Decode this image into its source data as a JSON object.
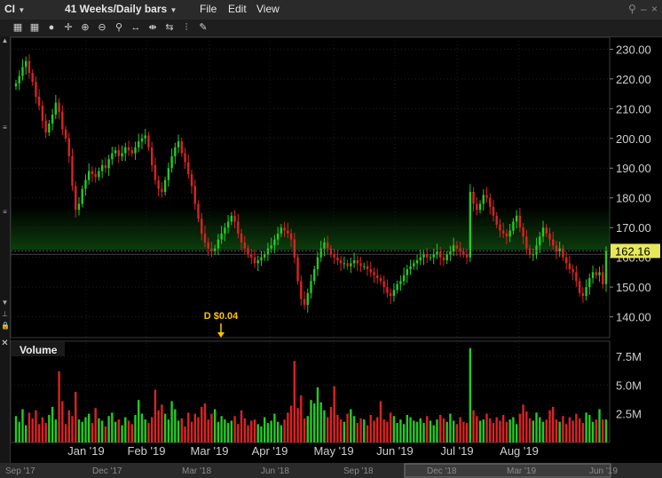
{
  "header": {
    "symbol": "CI",
    "period": "41 Weeks/Daily bars",
    "menu": [
      "File",
      "Edit",
      "View"
    ]
  },
  "toolbar": {
    "icons": [
      "grid-icon",
      "grid-icon",
      "circle-icon",
      "crosshair-icon",
      "zoom-in-icon",
      "zoom-out-icon",
      "magnify-icon",
      "fit-icon",
      "compress-icon",
      "expand-icon",
      "bar-marker-icon",
      "draw-icon"
    ]
  },
  "colors": {
    "up": "#22cc22",
    "down": "#dd2222",
    "band": "#0c3d0c",
    "price_tag": "#e8e85a",
    "dividend": "#ffc400",
    "axis_text": "#cfcfcf"
  },
  "price_label": "162.16",
  "dividend_label": "D $0.04",
  "volume_label": "Volume",
  "chart_data": [
    {
      "type": "candlestick",
      "title": "",
      "x_tick_labels": [
        "Jan '19",
        "Feb '19",
        "Mar '19",
        "Apr '19",
        "May '19",
        "Jun '19",
        "Jul '19",
        "Aug '19"
      ],
      "y_tick_labels": [
        "230.00",
        "220.00",
        "210.00",
        "200.00",
        "190.00",
        "180.00",
        "170.00",
        "160.00",
        "150.00",
        "140.00"
      ],
      "ylim": [
        133,
        234
      ],
      "grid": true,
      "last_price": 162.16,
      "closes": [
        218.5,
        221,
        224,
        226,
        222,
        219,
        214,
        211,
        206,
        202,
        205,
        208,
        212,
        209,
        203,
        200,
        194,
        184,
        176,
        178,
        183,
        186,
        189,
        188,
        187,
        189,
        191,
        190,
        193,
        195,
        196,
        194,
        195,
        197,
        196,
        195,
        197,
        199,
        200,
        201,
        197,
        191,
        186,
        183,
        182,
        186,
        190,
        194,
        197,
        199,
        195,
        192,
        188,
        184,
        178,
        173,
        168,
        165,
        163,
        162,
        163,
        166,
        168,
        170,
        172,
        174,
        172,
        168,
        165,
        163,
        161,
        160,
        158,
        159,
        160,
        161,
        163,
        164,
        166,
        168,
        170,
        169,
        168,
        166,
        160,
        152,
        146,
        144,
        148,
        152,
        156,
        160,
        163,
        165,
        163,
        161,
        160,
        159,
        158,
        158,
        157,
        158,
        159,
        158,
        157,
        157,
        156,
        155,
        154,
        153,
        152,
        150,
        148,
        147,
        149,
        151,
        152,
        154,
        156,
        157,
        158,
        159,
        160,
        161,
        160,
        160,
        161,
        162,
        160,
        159,
        161,
        162,
        164,
        163,
        162,
        161,
        160,
        182,
        178,
        176,
        178,
        181,
        180,
        177,
        174,
        171,
        169,
        168,
        167,
        169,
        172,
        174,
        170,
        167,
        163,
        161,
        161,
        164,
        167,
        170,
        168,
        166,
        164,
        162,
        163,
        160,
        158,
        156,
        155,
        152,
        148,
        147,
        150,
        153,
        155,
        154,
        155,
        151,
        162.16
      ],
      "y_volume_tick_labels": [
        "7.5M",
        "5.0M",
        "2.5M"
      ],
      "volume_ylim": [
        0,
        8.2
      ],
      "volume_m": [
        2.3,
        1.8,
        2.9,
        1.5,
        2.6,
        2.1,
        2.8,
        1.6,
        2.2,
        1.7,
        2.4,
        3.1,
        2.0,
        6.2,
        3.6,
        1.6,
        2.8,
        2.3,
        4.4,
        2.0,
        1.8,
        2.2,
        2.5,
        1.7,
        3.0,
        2.1,
        1.9,
        1.4,
        2.3,
        2.6,
        1.8,
        2.0,
        1.5,
        2.2,
        1.9,
        1.6,
        2.4,
        3.7,
        2.5,
        2.0,
        1.7,
        2.2,
        4.6,
        2.8,
        3.3,
        2.5,
        2.0,
        3.6,
        2.9,
        1.9,
        2.1,
        1.4,
        2.6,
        1.8,
        2.5,
        2.2,
        3.1,
        3.4,
        2.0,
        2.5,
        2.9,
        1.8,
        2.3,
        2.0,
        1.7,
        1.9,
        2.3,
        1.6,
        2.8,
        2.1,
        1.5,
        1.9,
        2.0,
        1.6,
        1.4,
        2.2,
        1.7,
        1.9,
        2.5,
        1.8,
        1.5,
        2.0,
        2.6,
        3.2,
        7.1,
        3.0,
        4.1,
        2.1,
        2.3,
        3.7,
        3.4,
        4.8,
        3.5,
        2.8,
        2.2,
        3.1,
        4.9,
        2.4,
        2.0,
        1.8,
        2.5,
        2.9,
        2.3,
        1.7,
        2.1,
        2.0,
        1.5,
        2.4,
        1.9,
        2.2,
        3.6,
        2.0,
        1.8,
        2.6,
        2.3,
        1.7,
        2.0,
        1.6,
        2.4,
        2.2,
        1.9,
        1.8,
        2.1,
        1.7,
        2.3,
        1.9,
        1.5,
        2.0,
        2.4,
        2.1,
        1.8,
        2.5,
        1.9,
        1.6,
        2.2,
        1.8,
        1.7,
        8.2,
        2.8,
        2.3,
        1.9,
        2.0,
        2.5,
        2.1,
        1.7,
        2.2,
        1.9,
        2.4,
        1.8,
        2.0,
        2.2,
        1.6,
        2.5,
        3.3,
        2.7,
        2.1,
        1.9,
        2.6,
        2.2,
        1.8,
        2.0,
        2.8,
        3.1,
        2.0,
        1.8,
        2.3,
        1.6,
        2.2,
        1.9,
        2.5,
        2.1,
        1.7,
        2.6,
        2.4,
        1.8,
        2.0,
        2.9
      ]
    }
  ],
  "timeline_labels": [
    "Sep '17",
    "Dec '17",
    "Mar '18",
    "Jun '18",
    "Sep '18",
    "Dec '18",
    "Mar '19",
    "Jun '19"
  ]
}
